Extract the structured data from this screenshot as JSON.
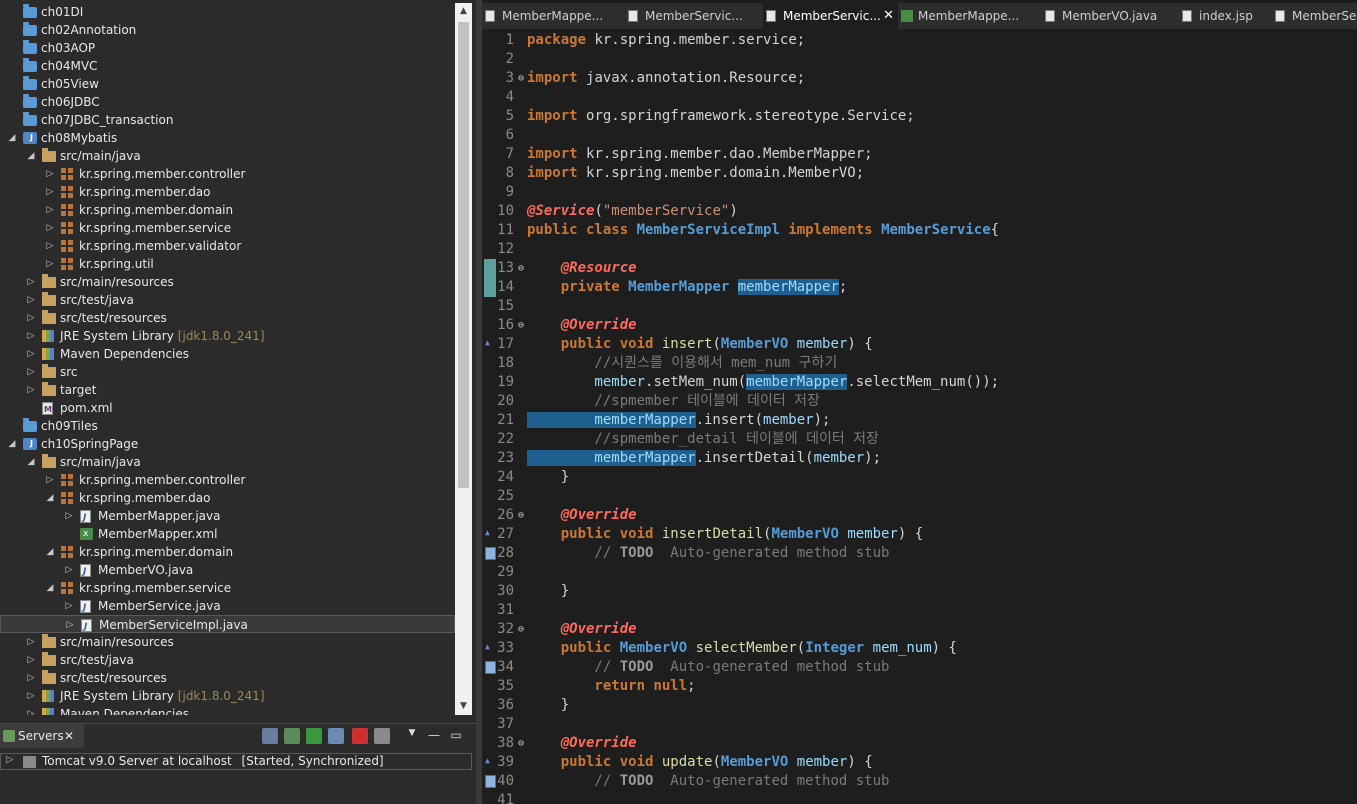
{
  "tree": [
    {
      "indent": 0,
      "tw": "",
      "icon": "folder",
      "label": "ch01DI"
    },
    {
      "indent": 0,
      "tw": "",
      "icon": "folder",
      "label": "ch02Annotation"
    },
    {
      "indent": 0,
      "tw": "",
      "icon": "folder",
      "label": "ch03AOP"
    },
    {
      "indent": 0,
      "tw": "",
      "icon": "folder",
      "label": "ch04MVC"
    },
    {
      "indent": 0,
      "tw": "",
      "icon": "folder",
      "label": "ch05View"
    },
    {
      "indent": 0,
      "tw": "",
      "icon": "folder",
      "label": "ch06JDBC"
    },
    {
      "indent": 0,
      "tw": "",
      "icon": "folder",
      "label": "ch07JDBC_transaction"
    },
    {
      "indent": 0,
      "tw": "◢",
      "icon": "project",
      "label": "ch08Mybatis"
    },
    {
      "indent": 1,
      "tw": "◢",
      "icon": "srcfolder",
      "label": "src/main/java"
    },
    {
      "indent": 2,
      "tw": "▷",
      "icon": "package",
      "label": "kr.spring.member.controller"
    },
    {
      "indent": 2,
      "tw": "▷",
      "icon": "package",
      "label": "kr.spring.member.dao"
    },
    {
      "indent": 2,
      "tw": "▷",
      "icon": "package",
      "label": "kr.spring.member.domain"
    },
    {
      "indent": 2,
      "tw": "▷",
      "icon": "package",
      "label": "kr.spring.member.service"
    },
    {
      "indent": 2,
      "tw": "▷",
      "icon": "package",
      "label": "kr.spring.member.validator"
    },
    {
      "indent": 2,
      "tw": "▷",
      "icon": "package",
      "label": "kr.spring.util"
    },
    {
      "indent": 1,
      "tw": "▷",
      "icon": "srcfolder",
      "label": "src/main/resources"
    },
    {
      "indent": 1,
      "tw": "▷",
      "icon": "srcfolder",
      "label": "src/test/java"
    },
    {
      "indent": 1,
      "tw": "▷",
      "icon": "srcfolder",
      "label": "src/test/resources"
    },
    {
      "indent": 1,
      "tw": "▷",
      "icon": "library",
      "label": "JRE System Library",
      "deco": "[jdk1.8.0_241]"
    },
    {
      "indent": 1,
      "tw": "▷",
      "icon": "library",
      "label": "Maven Dependencies"
    },
    {
      "indent": 1,
      "tw": "▷",
      "icon": "srcfolder",
      "label": "src"
    },
    {
      "indent": 1,
      "tw": "▷",
      "icon": "srcfolder",
      "label": "target"
    },
    {
      "indent": 1,
      "tw": "",
      "icon": "pom",
      "label": "pom.xml"
    },
    {
      "indent": 0,
      "tw": "",
      "icon": "folder",
      "label": "ch09Tiles"
    },
    {
      "indent": 0,
      "tw": "◢",
      "icon": "project",
      "label": "ch10SpringPage"
    },
    {
      "indent": 1,
      "tw": "◢",
      "icon": "srcfolder",
      "label": "src/main/java"
    },
    {
      "indent": 2,
      "tw": "▷",
      "icon": "package",
      "label": "kr.spring.member.controller"
    },
    {
      "indent": 2,
      "tw": "◢",
      "icon": "package",
      "label": "kr.spring.member.dao"
    },
    {
      "indent": 3,
      "tw": "▷",
      "icon": "java",
      "label": "MemberMapper.java"
    },
    {
      "indent": 3,
      "tw": "",
      "icon": "xml",
      "label": "MemberMapper.xml"
    },
    {
      "indent": 2,
      "tw": "◢",
      "icon": "package",
      "label": "kr.spring.member.domain"
    },
    {
      "indent": 3,
      "tw": "▷",
      "icon": "java",
      "label": "MemberVO.java"
    },
    {
      "indent": 2,
      "tw": "◢",
      "icon": "package",
      "label": "kr.spring.member.service"
    },
    {
      "indent": 3,
      "tw": "▷",
      "icon": "java",
      "label": "MemberService.java"
    },
    {
      "indent": 3,
      "tw": "▷",
      "icon": "java",
      "label": "MemberServiceImpl.java",
      "selected": true
    },
    {
      "indent": 1,
      "tw": "▷",
      "icon": "srcfolder",
      "label": "src/main/resources"
    },
    {
      "indent": 1,
      "tw": "▷",
      "icon": "srcfolder",
      "label": "src/test/java"
    },
    {
      "indent": 1,
      "tw": "▷",
      "icon": "srcfolder",
      "label": "src/test/resources"
    },
    {
      "indent": 1,
      "tw": "▷",
      "icon": "library",
      "label": "JRE System Library",
      "deco": "[jdk1.8.0_241]"
    },
    {
      "indent": 1,
      "tw": "▷",
      "icon": "library",
      "label": "Maven Dependencies"
    }
  ],
  "servers": {
    "tab_label": "Servers",
    "close_glyph": "✕",
    "server_label": "Tomcat v9.0 Server at localhost",
    "server_state": "[Started, Synchronized]"
  },
  "tabs": [
    {
      "label": "MemberMappe...",
      "icon": "java"
    },
    {
      "label": "MemberServic...",
      "icon": "java"
    },
    {
      "label": "MemberServic...",
      "icon": "java",
      "active": true,
      "close": "✕"
    },
    {
      "label": "MemberMappe...",
      "icon": "xml"
    },
    {
      "label": "MemberVO.java",
      "icon": "java"
    },
    {
      "label": "index.jsp",
      "icon": "jsp"
    },
    {
      "label": "MemberSe",
      "icon": "java"
    }
  ],
  "code": [
    {
      "n": "1",
      "segs": [
        [
          "kw",
          "package"
        ],
        [
          "",
          "kr.spring.member.service;"
        ]
      ]
    },
    {
      "n": "2",
      "segs": []
    },
    {
      "n": "3",
      "fold": "⊖",
      "segs": [
        [
          "kw",
          "import"
        ],
        [
          "",
          "javax.annotation.Resource;"
        ]
      ]
    },
    {
      "n": "4",
      "segs": []
    },
    {
      "n": "5",
      "segs": [
        [
          "kw",
          "import"
        ],
        [
          "",
          "org.springframework.stereotype.Service;"
        ]
      ]
    },
    {
      "n": "6",
      "segs": []
    },
    {
      "n": "7",
      "segs": [
        [
          "kw",
          "import"
        ],
        [
          "",
          "kr.spring.member.dao.MemberMapper;"
        ]
      ]
    },
    {
      "n": "8",
      "segs": [
        [
          "kw",
          "import"
        ],
        [
          "",
          "kr.spring.member.domain.MemberVO;"
        ]
      ]
    },
    {
      "n": "9",
      "segs": []
    },
    {
      "n": "10",
      "segs": [
        [
          "an",
          "@Service"
        ],
        [
          "",
          "("
        ],
        [
          "st",
          "\"memberService\""
        ],
        [
          "",
          ")"
        ]
      ]
    },
    {
      "n": "11",
      "segs": [
        [
          "kw",
          "public class"
        ],
        [
          "ty",
          "MemberServiceImpl"
        ],
        [
          "kw",
          "implements"
        ],
        [
          "ty",
          "MemberService"
        ],
        [
          "",
          "{"
        ]
      ]
    },
    {
      "n": "12",
      "segs": []
    },
    {
      "n": "13",
      "fold": "⊖",
      "gut": "hl",
      "segs": [
        [
          "an",
          "    @Resource"
        ]
      ]
    },
    {
      "n": "14",
      "gut": "hl",
      "segs": [
        [
          "kw",
          "    private"
        ],
        [
          "ty",
          "MemberMapper"
        ],
        [
          "sel va",
          "memberMapper"
        ],
        [
          "",
          ";"
        ]
      ]
    },
    {
      "n": "15",
      "segs": []
    },
    {
      "n": "16",
      "fold": "⊖",
      "segs": [
        [
          "an",
          "    @Override"
        ]
      ]
    },
    {
      "n": "17",
      "gut": "ovr",
      "segs": [
        [
          "kw",
          "    public void"
        ],
        [
          "fn",
          "insert"
        ],
        [
          "",
          "("
        ],
        [
          "ty",
          "MemberVO"
        ],
        [
          "va",
          "member"
        ],
        [
          "",
          ") {"
        ]
      ]
    },
    {
      "n": "18",
      "segs": [
        [
          "cm",
          "        //시퀀스를 이용해서 mem_num 구하기"
        ]
      ]
    },
    {
      "n": "19",
      "segs": [
        [
          "va",
          "        member"
        ],
        [
          "",
          ".setMem_num("
        ],
        [
          "sel va",
          "memberMapper"
        ],
        [
          "",
          ".selectMem_num());"
        ]
      ]
    },
    {
      "n": "20",
      "segs": [
        [
          "cm",
          "        //spmember 테이블에 데이터 저장"
        ]
      ]
    },
    {
      "n": "21",
      "segs": [
        [
          "sel va",
          "        memberMapper"
        ],
        [
          "",
          ".insert("
        ],
        [
          "va",
          "member"
        ],
        [
          "",
          ");"
        ]
      ]
    },
    {
      "n": "22",
      "segs": [
        [
          "cm",
          "        //spmember_detail 테이블에 데이터 저장"
        ]
      ]
    },
    {
      "n": "23",
      "segs": [
        [
          "sel va",
          "        memberMapper"
        ],
        [
          "",
          ".insertDetail("
        ],
        [
          "va",
          "member"
        ],
        [
          "",
          ");"
        ]
      ]
    },
    {
      "n": "24",
      "segs": [
        [
          "",
          "    }"
        ]
      ]
    },
    {
      "n": "25",
      "segs": []
    },
    {
      "n": "26",
      "fold": "⊖",
      "segs": [
        [
          "an",
          "    @Override"
        ]
      ]
    },
    {
      "n": "27",
      "gut": "ovr",
      "segs": [
        [
          "kw",
          "    public void"
        ],
        [
          "fn",
          "insertDetail"
        ],
        [
          "",
          "("
        ],
        [
          "ty",
          "MemberVO"
        ],
        [
          "va",
          "member"
        ],
        [
          "",
          ") {"
        ]
      ]
    },
    {
      "n": "28",
      "gut": "todo",
      "segs": [
        [
          "cm",
          "        // "
        ],
        [
          "td",
          "TODO"
        ],
        [
          "cm",
          " Auto-generated method stub"
        ]
      ]
    },
    {
      "n": "29",
      "segs": []
    },
    {
      "n": "30",
      "segs": [
        [
          "",
          "    }"
        ]
      ]
    },
    {
      "n": "31",
      "segs": []
    },
    {
      "n": "32",
      "fold": "⊖",
      "segs": [
        [
          "an",
          "    @Override"
        ]
      ]
    },
    {
      "n": "33",
      "gut": "ovr",
      "segs": [
        [
          "kw",
          "    public"
        ],
        [
          "ty",
          "MemberVO"
        ],
        [
          "fn",
          "selectMember"
        ],
        [
          "",
          "("
        ],
        [
          "ty",
          "Integer"
        ],
        [
          "va",
          "mem_num"
        ],
        [
          "",
          ") {"
        ]
      ]
    },
    {
      "n": "34",
      "gut": "todo",
      "segs": [
        [
          "cm",
          "        // "
        ],
        [
          "td",
          "TODO"
        ],
        [
          "cm",
          " Auto-generated method stub"
        ]
      ]
    },
    {
      "n": "35",
      "segs": [
        [
          "kw",
          "        return null"
        ],
        [
          "",
          ";"
        ]
      ]
    },
    {
      "n": "36",
      "segs": [
        [
          "",
          "    }"
        ]
      ]
    },
    {
      "n": "37",
      "segs": []
    },
    {
      "n": "38",
      "fold": "⊖",
      "segs": [
        [
          "an",
          "    @Override"
        ]
      ]
    },
    {
      "n": "39",
      "gut": "ovr",
      "segs": [
        [
          "kw",
          "    public void"
        ],
        [
          "fn",
          "update"
        ],
        [
          "",
          "("
        ],
        [
          "ty",
          "MemberVO"
        ],
        [
          "va",
          "member"
        ],
        [
          "",
          ") {"
        ]
      ]
    },
    {
      "n": "40",
      "gut": "todo",
      "segs": [
        [
          "cm",
          "        // "
        ],
        [
          "td",
          "TODO"
        ],
        [
          "cm",
          " Auto-generated method stub"
        ]
      ]
    },
    {
      "n": "41",
      "segs": []
    }
  ]
}
